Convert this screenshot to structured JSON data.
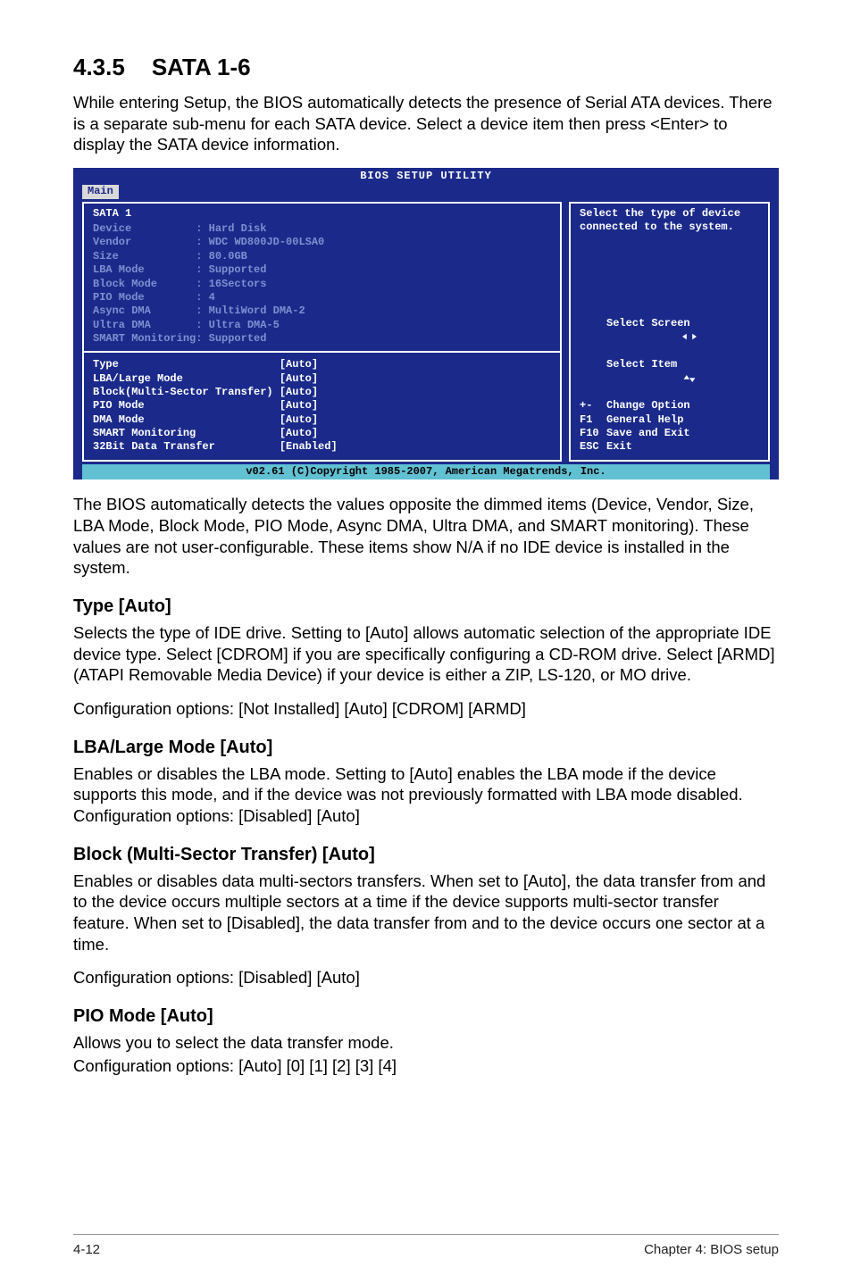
{
  "section": {
    "number": "4.3.5",
    "title": "SATA 1-6"
  },
  "intro": "While entering Setup, the BIOS automatically detects the presence of Serial ATA devices. There is a separate sub-menu for each SATA device. Select a device item then press <Enter> to display the SATA device information.",
  "bios": {
    "title": "BIOS SETUP UTILITY",
    "tab": "Main",
    "device_header": "SATA 1",
    "dimmed": [
      {
        "label": "Device",
        "value": "Hard Disk"
      },
      {
        "label": "Vendor",
        "value": "WDC WD800JD-00LSA0"
      },
      {
        "label": "Size",
        "value": "80.0GB"
      },
      {
        "label": "LBA Mode",
        "value": "Supported"
      },
      {
        "label": "Block Mode",
        "value": "16Sectors"
      },
      {
        "label": "PIO Mode",
        "value": "4"
      },
      {
        "label": "Async DMA",
        "value": "MultiWord DMA-2"
      },
      {
        "label": "Ultra DMA",
        "value": "Ultra DMA-5"
      },
      {
        "label": "SMART Monitoring",
        "value": "Supported"
      }
    ],
    "options": [
      {
        "label": "Type",
        "value": "[Auto]"
      },
      {
        "label": "LBA/Large Mode",
        "value": "[Auto]"
      },
      {
        "label": "Block(Multi-Sector Transfer)",
        "value": "[Auto]"
      },
      {
        "label": "PIO Mode",
        "value": "[Auto]"
      },
      {
        "label": "DMA Mode",
        "value": "[Auto]"
      },
      {
        "label": "SMART Monitoring",
        "value": "[Auto]"
      },
      {
        "label": "32Bit Data Transfer",
        "value": "[Enabled]"
      }
    ],
    "help_desc": "Select the type of device connected to the system.",
    "help_keys": [
      {
        "key": "←→",
        "text": "Select Screen"
      },
      {
        "key": "↑↓",
        "text": "Select Item"
      },
      {
        "key": "+-",
        "text": "Change Option"
      },
      {
        "key": "F1",
        "text": "General Help"
      },
      {
        "key": "F10",
        "text": "Save and Exit"
      },
      {
        "key": "ESC",
        "text": "Exit"
      }
    ],
    "footer": "v02.61 (C)Copyright 1985-2007, American Megatrends, Inc."
  },
  "after_bios": "The BIOS automatically detects the values opposite the dimmed items (Device, Vendor, Size, LBA Mode, Block Mode, PIO Mode, Async DMA, Ultra DMA, and SMART monitoring). These values are not user-configurable. These items show N/A if no IDE device is installed in the system.",
  "blocks": {
    "type": {
      "heading": "Type [Auto]",
      "p1": "Selects the type of IDE drive. Setting to [Auto] allows automatic selection of the appropriate IDE device type. Select [CDROM] if you are specifically configuring a CD-ROM drive. Select [ARMD] (ATAPI Removable Media Device) if your device is either a ZIP, LS-120, or MO drive.",
      "p2": "Configuration options: [Not Installed] [Auto] [CDROM] [ARMD]"
    },
    "lba": {
      "heading": "LBA/Large Mode [Auto]",
      "p1": "Enables or disables the LBA mode. Setting to [Auto] enables the LBA mode if the device supports this mode, and if the device was not previously formatted with LBA mode disabled. Configuration options: [Disabled] [Auto]"
    },
    "block": {
      "heading": "Block (Multi-Sector Transfer) [Auto]",
      "p1": "Enables or disables data multi-sectors transfers. When set to [Auto], the data transfer from and to the device occurs multiple sectors at a time if the device supports multi-sector transfer feature. When set to [Disabled], the data transfer from and to the device occurs one sector at a time.",
      "p2": "Configuration options: [Disabled] [Auto]"
    },
    "pio": {
      "heading": "PIO Mode [Auto]",
      "p1": "Allows you to select the data transfer mode.",
      "p2": "Configuration options: [Auto] [0] [1] [2] [3] [4]"
    }
  },
  "footer": {
    "left": "4-12",
    "right": "Chapter 4: BIOS setup"
  }
}
